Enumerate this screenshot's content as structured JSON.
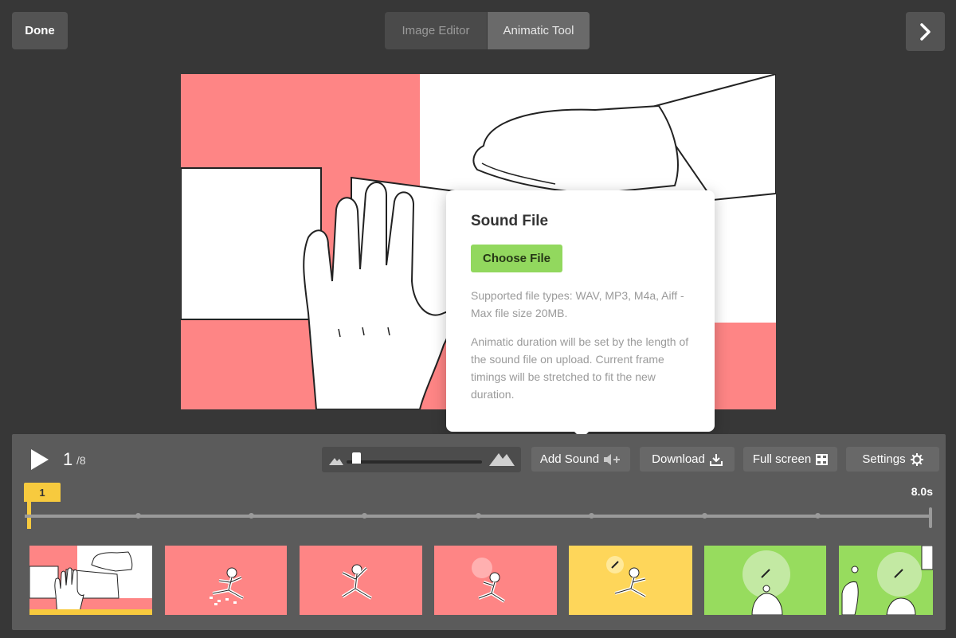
{
  "header": {
    "done_label": "Done",
    "tabs": [
      {
        "label": "Image Editor",
        "active": false
      },
      {
        "label": "Animatic Tool",
        "active": true
      }
    ],
    "next_icon": "chevron-right-icon"
  },
  "sound_popover": {
    "title": "Sound File",
    "choose_file_label": "Choose File",
    "supported_text": "Supported file types: WAV, MP3, M4a, Aiff - Max file size 20MB.",
    "duration_text": "Animatic duration will be set by the length of the sound file on upload. Current frame timings will be stretched to fit the new duration."
  },
  "player": {
    "current_frame": "1",
    "total_frames": "/8",
    "zoom_level": 0.05,
    "duration": "8.0s",
    "playhead_label": "1"
  },
  "toolbar": {
    "add_sound_label": "Add Sound",
    "download_label": "Download",
    "fullscreen_label": "Full screen",
    "settings_label": "Settings"
  },
  "colors": {
    "pink": "#fe8585",
    "yellow": "#fed65a",
    "green": "#97dc5e",
    "accent_yellow": "#f7ca3e",
    "button_green": "#92d85e"
  },
  "thumbnails": [
    {
      "bg": "#fe8585",
      "selected": true
    },
    {
      "bg": "#fe8585",
      "selected": false
    },
    {
      "bg": "#fe8585",
      "selected": false
    },
    {
      "bg": "#fe8585",
      "selected": false
    },
    {
      "bg": "#fed65a",
      "selected": false
    },
    {
      "bg": "#97dc5e",
      "selected": false
    },
    {
      "bg": "#97dc5e",
      "selected": false
    }
  ]
}
